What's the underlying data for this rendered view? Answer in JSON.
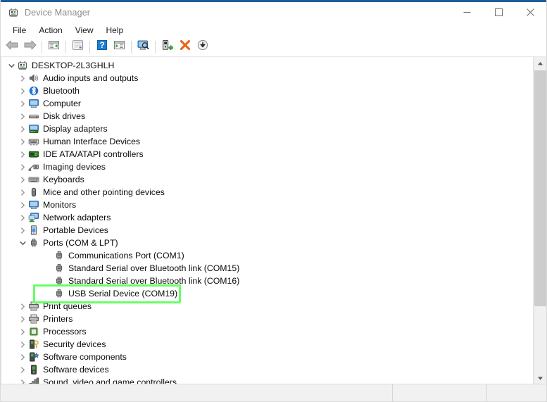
{
  "window": {
    "title": "Device Manager",
    "title_icon": "device-manager-icon",
    "accent_color": "#1f5c99",
    "controls": {
      "minimize": "minimize-button",
      "maximize": "maximize-button",
      "close": "close-button"
    }
  },
  "menubar": {
    "items": [
      {
        "label": "File"
      },
      {
        "label": "Action"
      },
      {
        "label": "View"
      },
      {
        "label": "Help"
      }
    ]
  },
  "toolbar": {
    "buttons": [
      {
        "icon": "back-arrow-icon",
        "name": "back-button"
      },
      {
        "icon": "forward-arrow-icon",
        "name": "forward-button"
      },
      {
        "icon": "show-hide-console-tree-icon",
        "name": "show-console-tree-button"
      },
      {
        "icon": "properties-icon",
        "name": "properties-button"
      },
      {
        "icon": "help-icon",
        "name": "help-button"
      },
      {
        "icon": "show-hide-action-pane-icon",
        "name": "show-action-pane-button"
      },
      {
        "icon": "scan-for-hardware-changes-icon",
        "name": "scan-hardware-changes-button"
      },
      {
        "icon": "update-driver-icon",
        "name": "update-driver-button"
      },
      {
        "icon": "uninstall-device-icon",
        "name": "uninstall-device-button"
      },
      {
        "icon": "disable-device-icon",
        "name": "disable-device-button"
      }
    ]
  },
  "tree": {
    "root": {
      "label": "DESKTOP-2L3GHLH",
      "icon": "computer-root-icon",
      "expanded": true
    },
    "nodes": [
      {
        "label": "Audio inputs and outputs",
        "icon": "speaker-icon",
        "expanded": false,
        "level": 1
      },
      {
        "label": "Bluetooth",
        "icon": "bluetooth-icon",
        "expanded": false,
        "level": 1
      },
      {
        "label": "Computer",
        "icon": "monitor-icon",
        "expanded": false,
        "level": 1
      },
      {
        "label": "Disk drives",
        "icon": "disk-drive-icon",
        "expanded": false,
        "level": 1
      },
      {
        "label": "Display adapters",
        "icon": "display-adapter-icon",
        "expanded": false,
        "level": 1
      },
      {
        "label": "Human Interface Devices",
        "icon": "hid-icon",
        "expanded": false,
        "level": 1
      },
      {
        "label": "IDE ATA/ATAPI controllers",
        "icon": "ide-controller-icon",
        "expanded": false,
        "level": 1
      },
      {
        "label": "Imaging devices",
        "icon": "imaging-device-icon",
        "expanded": false,
        "level": 1
      },
      {
        "label": "Keyboards",
        "icon": "keyboard-icon",
        "expanded": false,
        "level": 1
      },
      {
        "label": "Mice and other pointing devices",
        "icon": "mouse-icon",
        "expanded": false,
        "level": 1
      },
      {
        "label": "Monitors",
        "icon": "monitor-icon",
        "expanded": false,
        "level": 1
      },
      {
        "label": "Network adapters",
        "icon": "network-adapter-icon",
        "expanded": false,
        "level": 1
      },
      {
        "label": "Portable Devices",
        "icon": "portable-device-icon",
        "expanded": false,
        "level": 1
      },
      {
        "label": "Ports (COM & LPT)",
        "icon": "port-icon",
        "expanded": true,
        "level": 1
      },
      {
        "label": "Communications Port (COM1)",
        "icon": "port-icon",
        "expanded": null,
        "level": 2
      },
      {
        "label": "Standard Serial over Bluetooth link (COM15)",
        "icon": "port-icon",
        "expanded": null,
        "level": 2
      },
      {
        "label": "Standard Serial over Bluetooth link (COM16)",
        "icon": "port-icon",
        "expanded": null,
        "level": 2
      },
      {
        "label": "USB Serial Device (COM19)",
        "icon": "port-icon",
        "expanded": null,
        "level": 2,
        "highlighted": true
      },
      {
        "label": "Print queues",
        "icon": "printer-icon",
        "expanded": false,
        "level": 1
      },
      {
        "label": "Printers",
        "icon": "printer-icon",
        "expanded": false,
        "level": 1
      },
      {
        "label": "Processors",
        "icon": "processor-icon",
        "expanded": false,
        "level": 1
      },
      {
        "label": "Security devices",
        "icon": "security-device-icon",
        "expanded": false,
        "level": 1
      },
      {
        "label": "Software components",
        "icon": "software-component-icon",
        "expanded": false,
        "level": 1
      },
      {
        "label": "Software devices",
        "icon": "software-device-icon",
        "expanded": false,
        "level": 1
      },
      {
        "label": "Sound, video and game controllers",
        "icon": "sound-controller-icon",
        "expanded": false,
        "level": 1
      }
    ],
    "highlight_color": "#66ff66"
  },
  "scrollbar": {
    "up_arrow": "scroll-up-icon",
    "down_arrow": "scroll-down-icon"
  },
  "statusbar": {
    "cells": [
      "",
      "",
      ""
    ]
  }
}
